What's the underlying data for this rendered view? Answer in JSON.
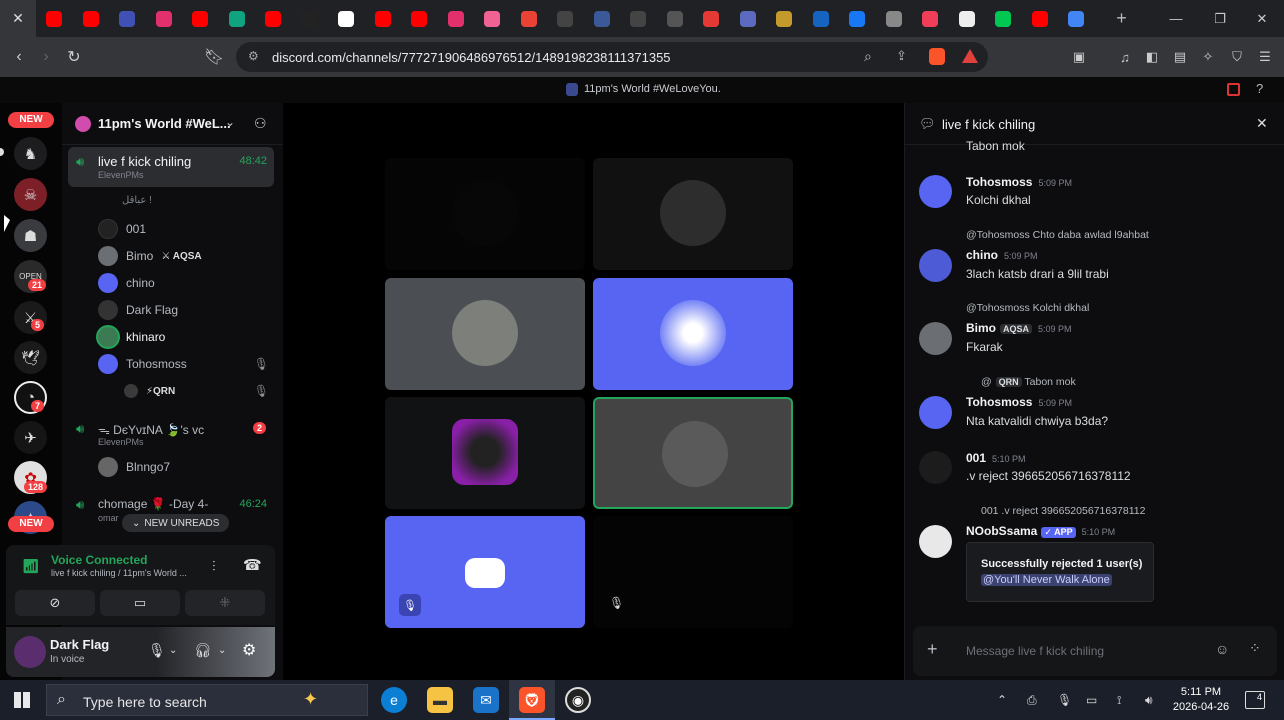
{
  "browser": {
    "tab_close": "✕",
    "new_tab": "+",
    "url": "discord.com/channels/777271906486976512/1489198238111371355",
    "favicon_colors": [
      "#ff0000",
      "#ff0000",
      "#3f51b5",
      "#e1306c",
      "#ff0000",
      "#10a37f",
      "#ff0000",
      "#222222",
      "#ffffff",
      "#ff0000",
      "#ff0000",
      "#e1306c",
      "#f06292",
      "#ea4335",
      "#444444",
      "#3b5998",
      "#444444",
      "#555555",
      "#e53935",
      "#5c6bc0",
      "#c49a2c",
      "#1565c0",
      "#1877f2",
      "#888888",
      "#f03e5a",
      "#eeeeee",
      "#00c853",
      "#ff0000",
      "#4285f4"
    ]
  },
  "discord_title": "11pm's World #WeLoveYou.",
  "rail": {
    "new_badge_top": "NEW",
    "new_badge_bottom": "NEW",
    "badges": [
      "21",
      "5",
      "7",
      "128"
    ]
  },
  "sidebar": {
    "guild_name": "11pm's World #WeL...",
    "active_channel": {
      "name": "live f kick chiling",
      "sub": "ElevenPMs",
      "time": "48:42"
    },
    "arabic_line": "عباقل !",
    "members": [
      {
        "name": "001"
      },
      {
        "name": "Bimo",
        "tag": "AQSA"
      },
      {
        "name": "chino"
      },
      {
        "name": "Dark Flag"
      },
      {
        "name": "khinaro"
      },
      {
        "name": "Tohosmoss"
      }
    ],
    "qrn_tag": "QRN",
    "channel2": {
      "name": "ᯓ DєYνɪNA 🍃's vc",
      "sub": "ElevenPMs",
      "unread": "2",
      "member": "Blnngo7"
    },
    "channel3": {
      "name": "chomage 🌹 -Day 4-",
      "sub": "omar",
      "time": "46:24"
    },
    "new_unreads": "NEW UNREADS"
  },
  "voice_panel": {
    "status": "Voice Connected",
    "sub": "live f kick chiling / 11pm's World ..."
  },
  "user": {
    "name": "Dark Flag",
    "status": "In voice"
  },
  "chat": {
    "title": "live f kick chiling",
    "top_cut": "Tabon mok",
    "messages": [
      {
        "author": "Tohosmoss",
        "time": "5:09 PM",
        "text": "Kolchi dkhal"
      },
      {
        "reply": "@Tohosmoss Chto daba awlad l9ahbat",
        "author": "chino",
        "time": "5:09 PM",
        "text": "3lach katsb drari a 9lil trabi"
      },
      {
        "reply": "@Tohosmoss Kolchi dkhal",
        "author": "Bimo",
        "tag": "AQSA",
        "time": "5:09 PM",
        "text": "Fkarak"
      },
      {
        "reply": "@",
        "reply_tag": "QRN",
        "reply_text": "Tabon mok",
        "author": "Tohosmoss",
        "time": "5:09 PM",
        "text": "Nta katvalidi chwiya b3da?"
      },
      {
        "author": "001",
        "time": "5:10 PM",
        "text": ".v reject 396652056716378112"
      },
      {
        "reply": "001 .v reject 396652056716378112",
        "author": "NOobSsama",
        "app_tag": "APP",
        "time": "5:10 PM"
      }
    ],
    "embed": {
      "line1": "Successfully rejected 1 user(s)",
      "line2": "@You'll Never Walk Alone"
    },
    "composer_placeholder": "Message live f kick chiling"
  },
  "taskbar": {
    "search_text": "Type here to search",
    "time": "5:11 PM",
    "date": "2026-04-26",
    "notif_count": "4"
  }
}
